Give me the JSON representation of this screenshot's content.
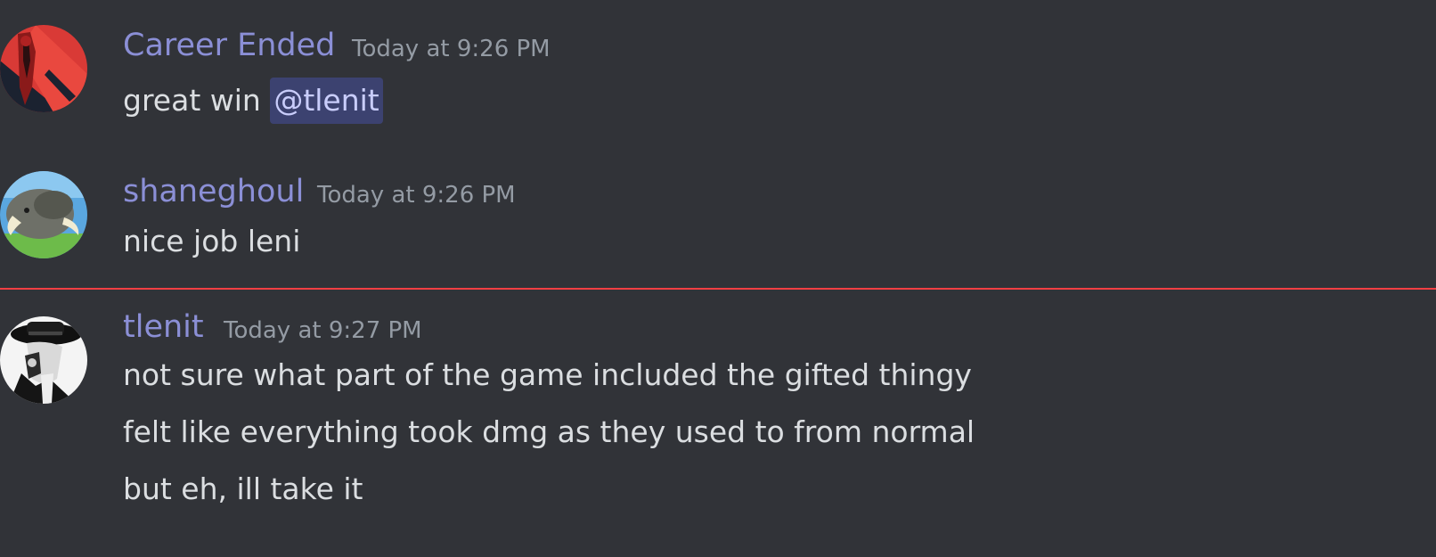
{
  "messages": [
    {
      "author": "Career Ended",
      "timestamp": "Today at 9:26 PM",
      "text_before_mention": "great win ",
      "mention": "@tlenit"
    },
    {
      "author": "shaneghoul",
      "timestamp": "Today at 9:26 PM",
      "lines": [
        "nice job leni"
      ]
    },
    {
      "author": "tlenit",
      "timestamp": "Today at 9:27 PM",
      "lines": [
        "not sure what part of the game included the gifted thingy",
        "felt like everything took dmg as they used to from normal",
        "but eh, ill take it"
      ]
    }
  ],
  "colors": {
    "background": "#313338",
    "username": "#8b8fd6",
    "timestamp": "#949ba4",
    "text": "#dbdee1",
    "mention_bg": "#3c4270",
    "mention_text": "#c9cdfb",
    "new_messages_divider": "#f23f43"
  },
  "icons": {
    "avatar_1": "red-black-anime-avatar",
    "avatar_2": "pokemon-donphan-avatar",
    "avatar_3": "black-white-hat-man-avatar"
  }
}
